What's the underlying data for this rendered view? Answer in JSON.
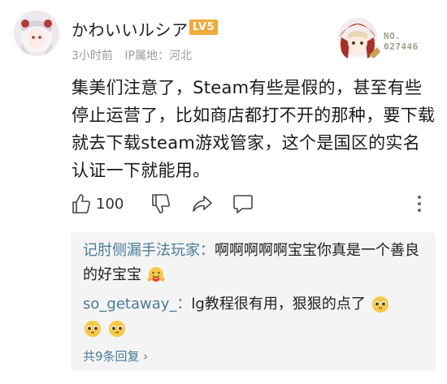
{
  "comment": {
    "username": "かわいいルシア",
    "level": "LV5",
    "time": "3小时前",
    "location": "IP属地：河北",
    "decoration_no": "NO.",
    "decoration_num": "027446",
    "text": "集美们注意了，Steam有些是假的，甚至有些停止运营了，比如商店都打不开的那种，要下载就去下载steam游戏管家，这个是国区的实名认证一下就能用。"
  },
  "actions": {
    "like_count": "100",
    "icons": [
      "thumbs-up-icon",
      "thumbs-down-icon",
      "share-icon",
      "comment-icon",
      "more-icon"
    ]
  },
  "replies": {
    "items": [
      {
        "user": "记肘侧漏手法玩家",
        "sep": "：",
        "text": "啊啊啊啊啊宝宝你真是一个善良的好宝宝"
      },
      {
        "user": "so_getaway_",
        "sep": "：",
        "text": "lg教程很有用，狠狠的点了"
      }
    ],
    "total": "共9条回复 ›"
  },
  "colors": {
    "reply_user": "#4b7a96",
    "level_badge": "#f0a93a",
    "meta": "#9a9a9a",
    "reply_bg": "#f4f4f4"
  }
}
